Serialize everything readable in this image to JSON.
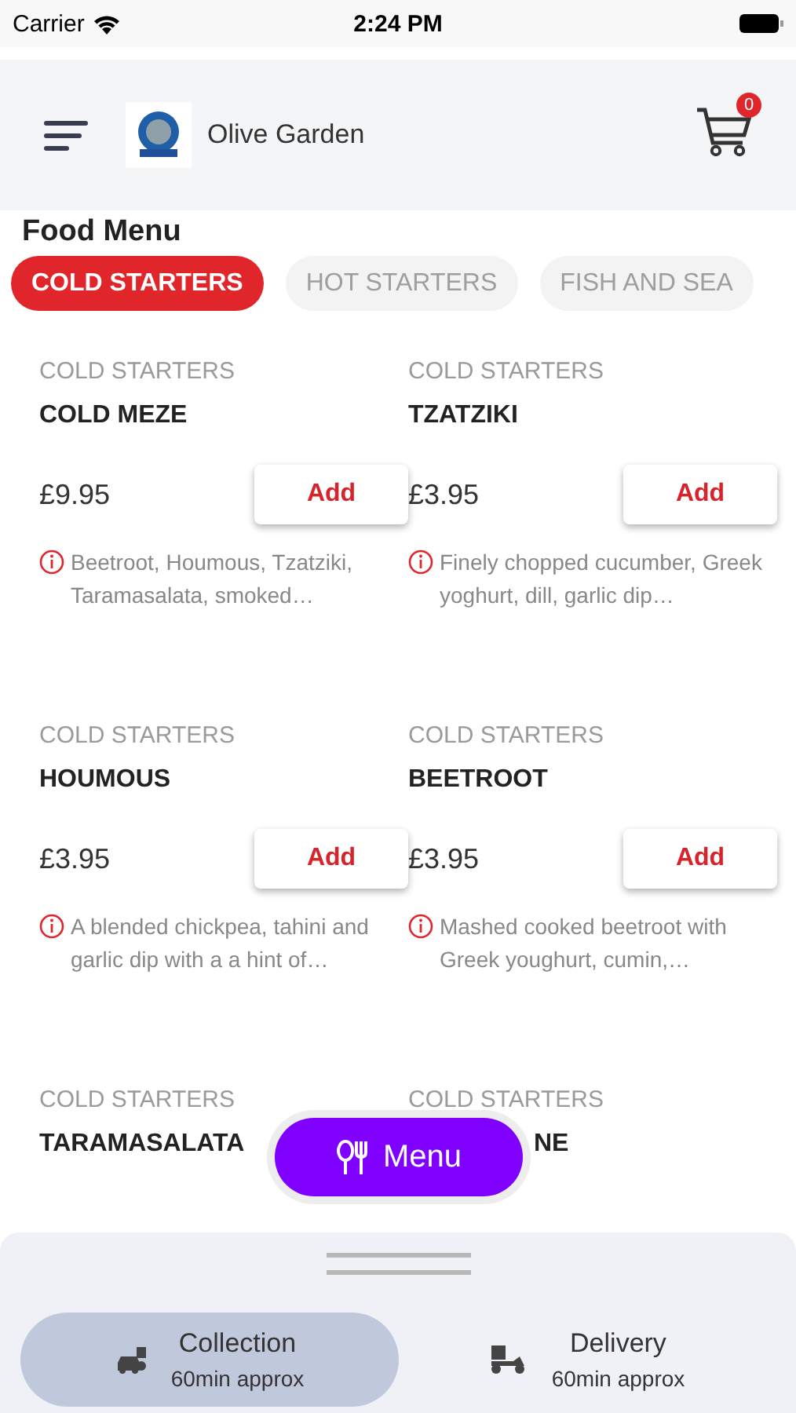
{
  "status_bar": {
    "carrier": "Carrier",
    "time": "2:24 PM"
  },
  "header": {
    "restaurant": "Olive Garden",
    "cart_count": "0"
  },
  "section_title": "Food Menu",
  "tabs": [
    {
      "label": "COLD STARTERS",
      "selected": true
    },
    {
      "label": "HOT STARTERS",
      "selected": false
    },
    {
      "label": "FISH AND SEA",
      "selected": false
    }
  ],
  "products": [
    {
      "category": "COLD STARTERS",
      "name": "COLD MEZE",
      "price": "£9.95",
      "button": "Add",
      "description": "Beetroot, Houmous, Tzatziki, Taramasalata, smoked…",
      "clipped": false
    },
    {
      "category": "COLD STARTERS",
      "name": "TZATZIKI",
      "price": "£3.95",
      "button": "Add",
      "description": "Finely chopped cucumber, Greek yoghurt, dill, garlic dip…",
      "clipped": false
    },
    {
      "category": "COLD STARTERS",
      "name": "HOUMOUS",
      "price": "£3.95",
      "button": "Add",
      "description": "A blended chickpea, tahini and garlic dip with a a hint of…",
      "clipped": false
    },
    {
      "category": "COLD STARTERS",
      "name": "BEETROOT",
      "price": "£3.95",
      "button": "Add",
      "description": "Mashed cooked beetroot with Greek youghurt, cumin,…",
      "clipped": false
    },
    {
      "category": "COLD STARTERS",
      "name": "TARAMASALATA",
      "clipped": false
    },
    {
      "category": "COLD STARTERS",
      "name": "NE",
      "clipped": true
    }
  ],
  "menu_button": "Menu",
  "order_types": [
    {
      "kind": "collection",
      "label": "Collection",
      "time": "60min approx",
      "selected": true
    },
    {
      "kind": "delivery",
      "label": "Delivery",
      "time": "60min approx",
      "selected": false
    }
  ]
}
